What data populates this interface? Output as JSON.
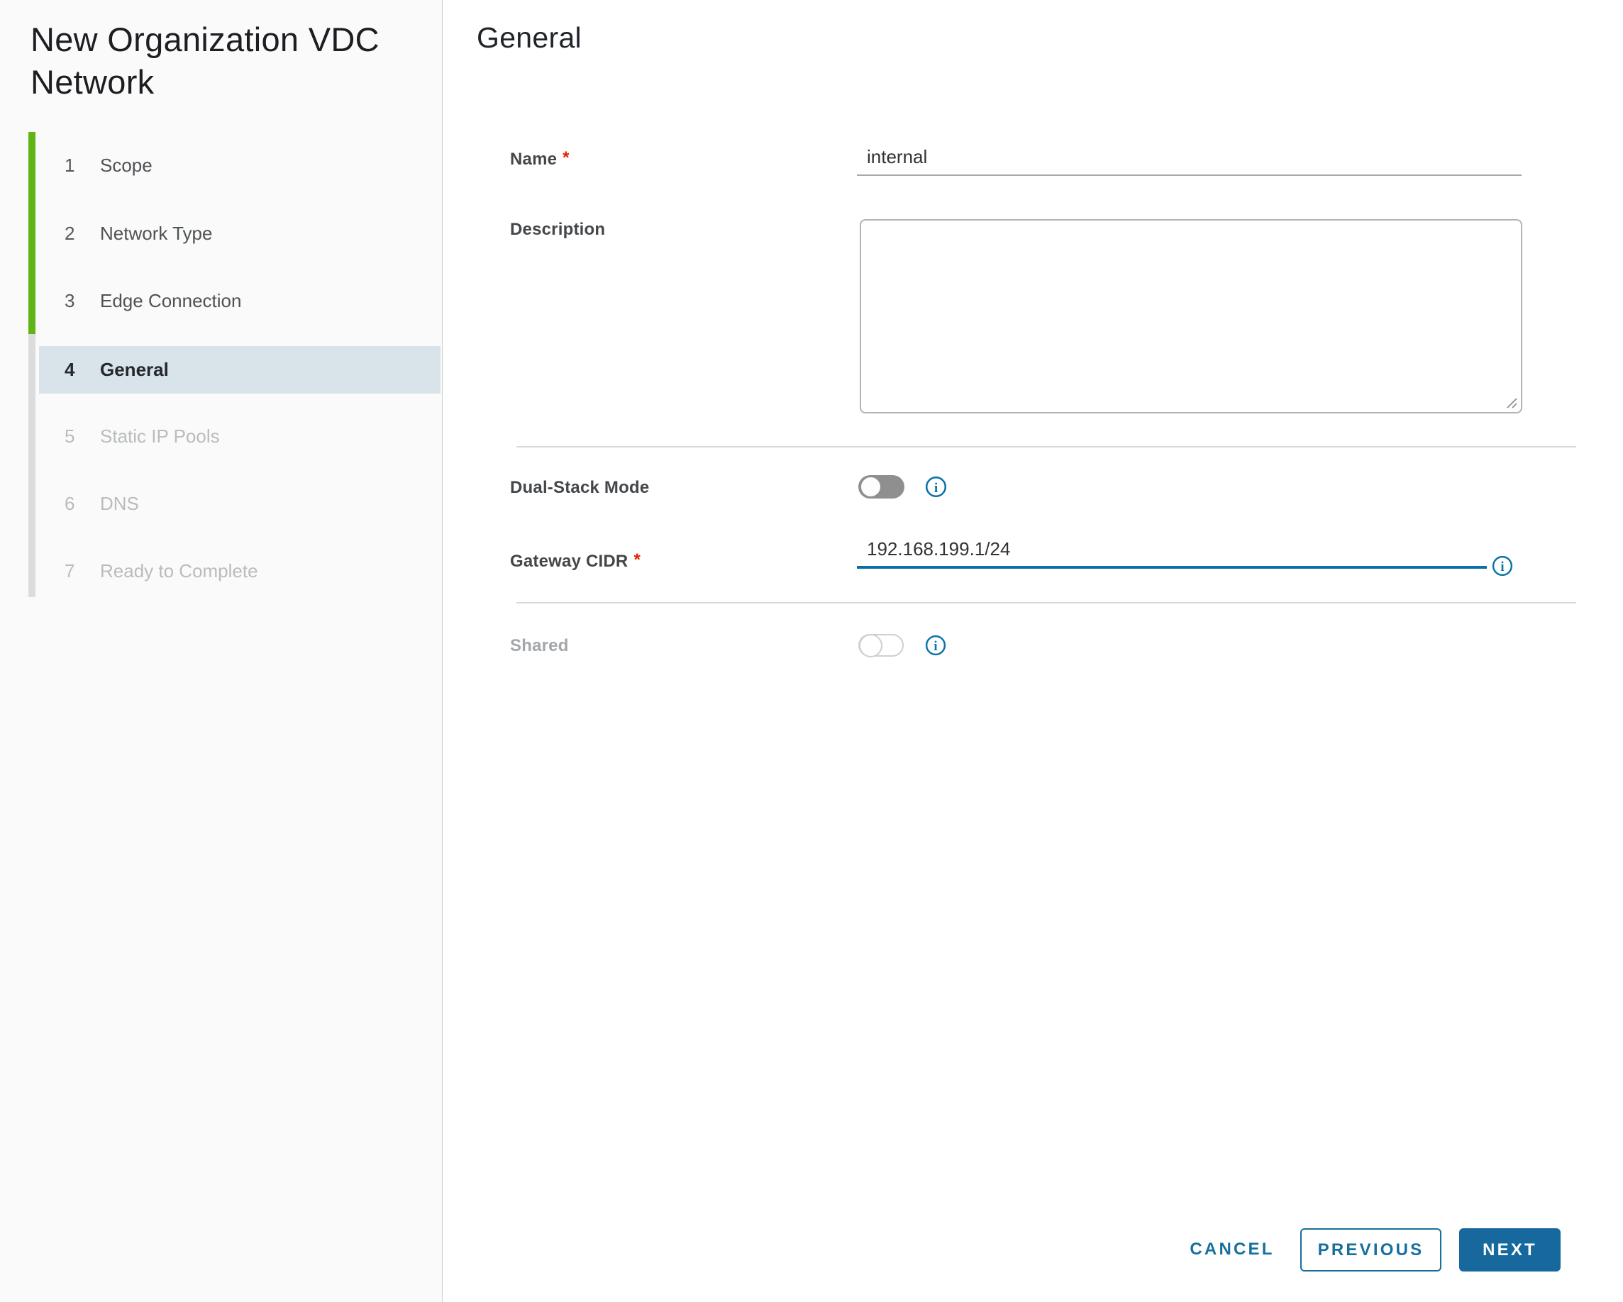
{
  "wizard": {
    "title": "New Organization VDC Network",
    "steps": [
      {
        "num": "1",
        "label": "Scope",
        "state": "complete"
      },
      {
        "num": "2",
        "label": "Network Type",
        "state": "complete"
      },
      {
        "num": "3",
        "label": "Edge Connection",
        "state": "complete"
      },
      {
        "num": "4",
        "label": "General",
        "state": "current"
      },
      {
        "num": "5",
        "label": "Static IP Pools",
        "state": "upcoming"
      },
      {
        "num": "6",
        "label": "DNS",
        "state": "upcoming"
      },
      {
        "num": "7",
        "label": "Ready to Complete",
        "state": "upcoming"
      }
    ]
  },
  "page": {
    "heading": "General"
  },
  "form": {
    "required_marker": "*",
    "name": {
      "label": "Name",
      "required": true,
      "value": "internal"
    },
    "description": {
      "label": "Description",
      "value": ""
    },
    "dual_stack": {
      "label": "Dual-Stack Mode",
      "enabled": false
    },
    "gateway_cidr": {
      "label": "Gateway CIDR",
      "required": true,
      "value": "192.168.199.1/24",
      "focused": true
    },
    "shared": {
      "label": "Shared",
      "enabled": false,
      "disabled": true
    }
  },
  "footer": {
    "cancel_label": "CANCEL",
    "previous_label": "PREVIOUS",
    "next_label": "NEXT"
  },
  "colors": {
    "accent_blue": "#17699d",
    "info_blue": "#0c74a8",
    "focus_underline_blue": "#0a6fa6",
    "progress_green": "#60b515",
    "active_step_bg": "#d8e3ea",
    "sidebar_bg": "#fafafa",
    "required_red": "#e12200"
  }
}
